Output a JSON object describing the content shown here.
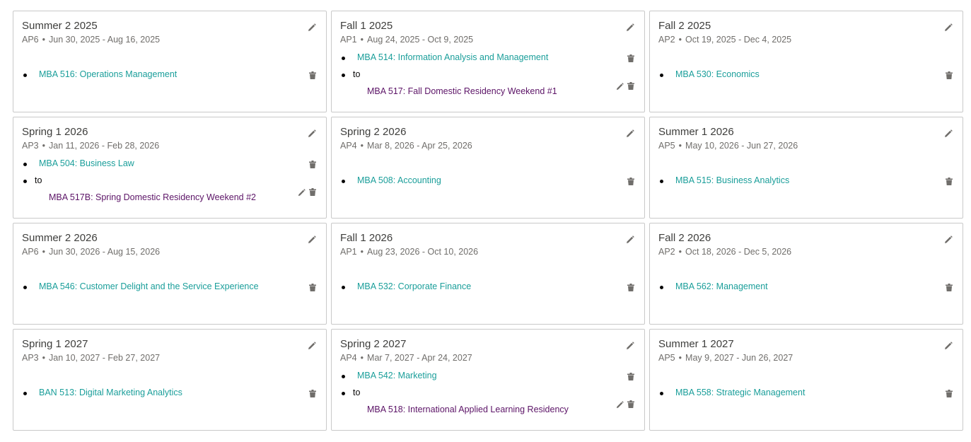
{
  "colors": {
    "course_link": "#1a9e9a",
    "residency_link": "#5c1467",
    "border": "#c9c9c9",
    "icon": "#706e6b"
  },
  "icons": {
    "edit": "pencil-icon",
    "delete": "trash-icon"
  },
  "terms": [
    {
      "title": "Summer 2 2025",
      "period": "AP6",
      "dates": "Jun 30, 2025 - Aug 16, 2025",
      "courses": [
        "MBA 516: Operations Management"
      ]
    },
    {
      "title": "Fall 1 2025",
      "period": "AP1",
      "dates": "Aug 24, 2025 - Oct 9, 2025",
      "courses": [
        "MBA 514: Information Analysis and Management"
      ],
      "to_label": "to",
      "residency": "MBA 517: Fall Domestic Residency Weekend #1"
    },
    {
      "title": "Fall 2 2025",
      "period": "AP2",
      "dates": "Oct 19, 2025 - Dec 4, 2025",
      "courses": [
        "MBA 530: Economics"
      ]
    },
    {
      "title": "Spring 1 2026",
      "period": "AP3",
      "dates": "Jan 11, 2026 - Feb 28, 2026",
      "courses": [
        "MBA 504: Business Law"
      ],
      "to_label": "to",
      "residency": "MBA 517B: Spring Domestic Residency Weekend #2"
    },
    {
      "title": "Spring 2 2026",
      "period": "AP4",
      "dates": "Mar 8, 2026 - Apr 25, 2026",
      "courses": [
        "MBA 508: Accounting"
      ]
    },
    {
      "title": "Summer 1 2026",
      "period": "AP5",
      "dates": "May 10, 2026 - Jun 27, 2026",
      "courses": [
        "MBA 515: Business Analytics"
      ]
    },
    {
      "title": "Summer 2 2026",
      "period": "AP6",
      "dates": "Jun 30, 2026 - Aug 15, 2026",
      "courses": [
        "MBA 546: Customer Delight and the Service Experience"
      ]
    },
    {
      "title": "Fall 1 2026",
      "period": "AP1",
      "dates": "Aug 23, 2026 - Oct 10, 2026",
      "courses": [
        "MBA 532: Corporate Finance"
      ]
    },
    {
      "title": "Fall 2 2026",
      "period": "AP2",
      "dates": "Oct 18, 2026 - Dec 5, 2026",
      "courses": [
        "MBA 562: Management"
      ]
    },
    {
      "title": "Spring 1 2027",
      "period": "AP3",
      "dates": "Jan 10, 2027 - Feb 27, 2027",
      "courses": [
        "BAN 513: Digital Marketing Analytics"
      ]
    },
    {
      "title": "Spring 2 2027",
      "period": "AP4",
      "dates": "Mar 7, 2027 - Apr 24, 2027",
      "courses": [
        "MBA 542: Marketing"
      ],
      "to_label": "to",
      "residency": "MBA 518: International Applied Learning Residency"
    },
    {
      "title": "Summer 1 2027",
      "period": "AP5",
      "dates": "May 9, 2027 - Jun 26, 2027",
      "courses": [
        "MBA 558: Strategic Management"
      ]
    }
  ]
}
